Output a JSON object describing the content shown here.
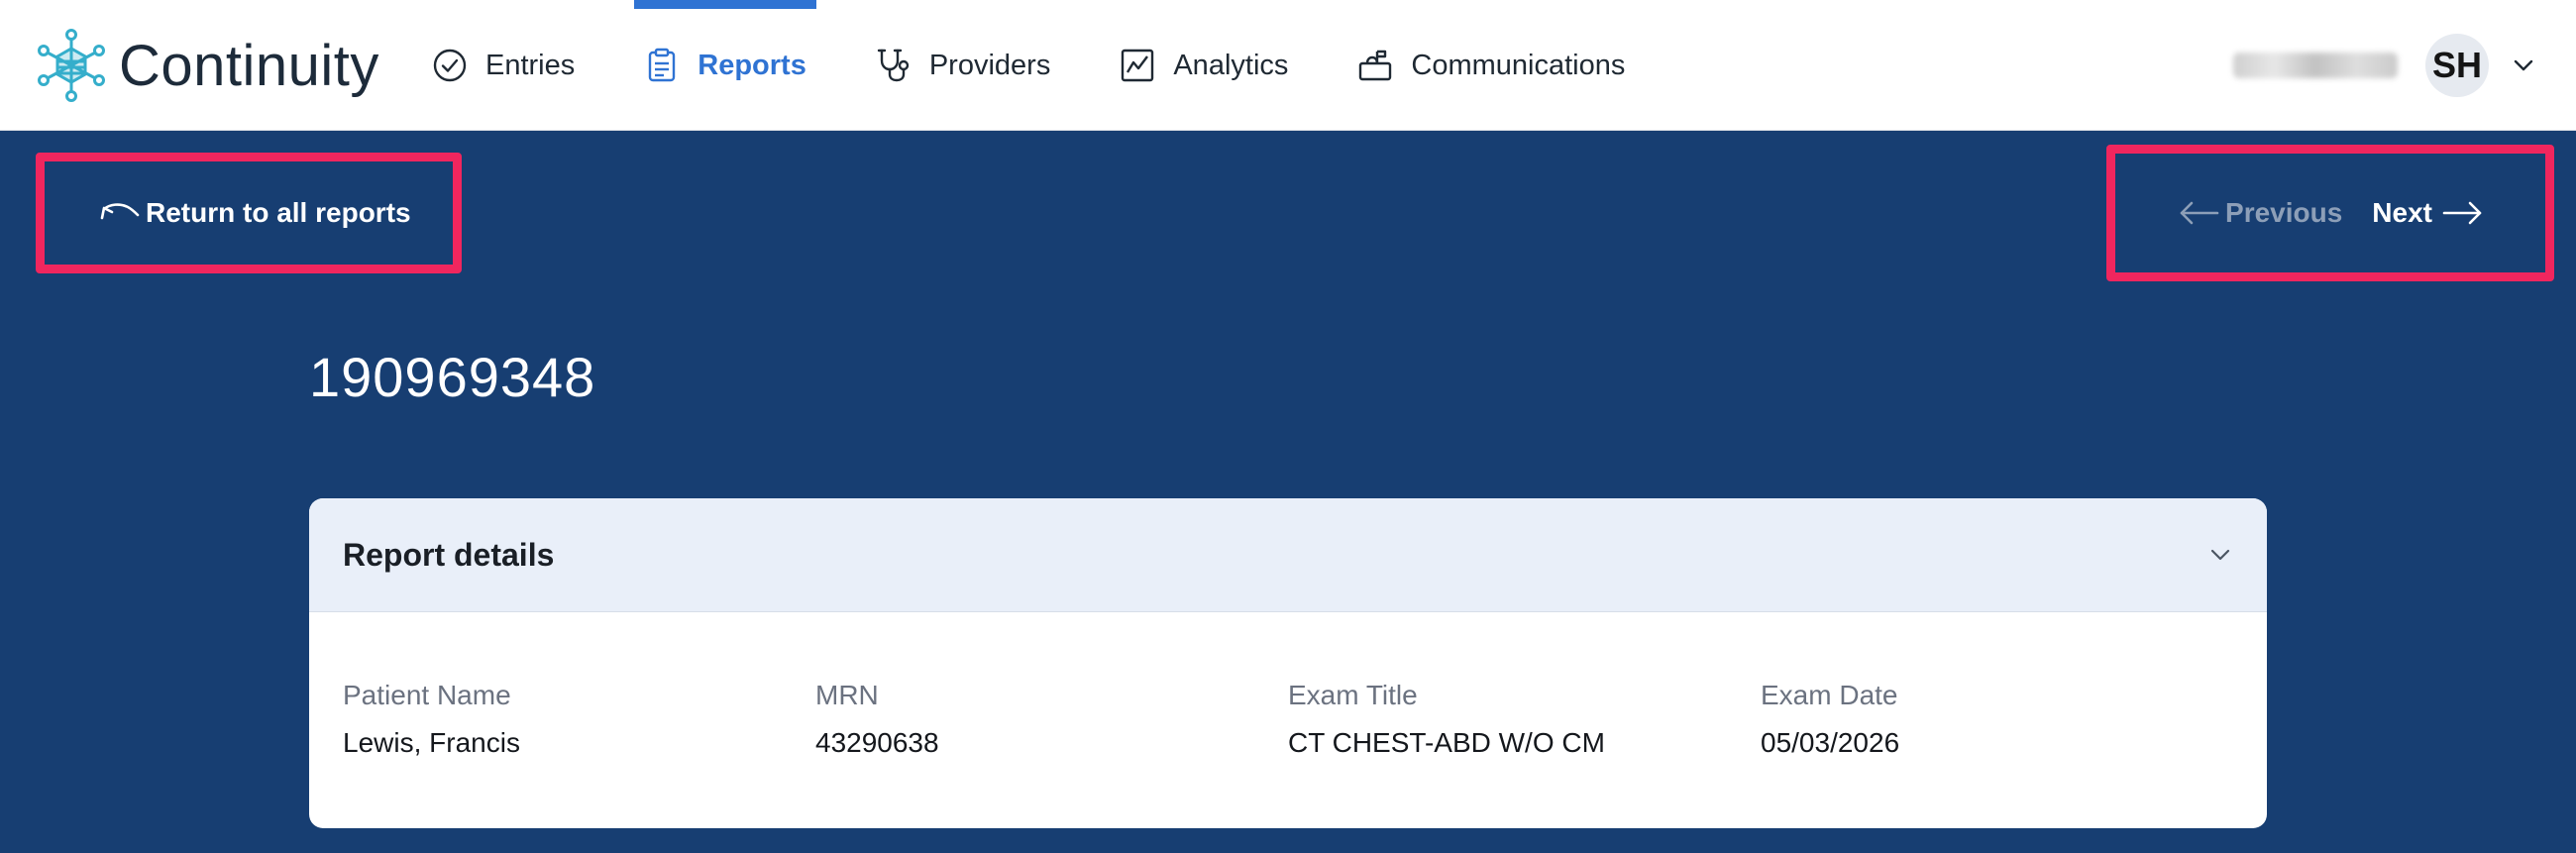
{
  "app": {
    "name": "Continuity"
  },
  "nav": {
    "items": [
      {
        "label": "Entries",
        "icon": "check-circle-icon",
        "active": false
      },
      {
        "label": "Reports",
        "icon": "clipboard-icon",
        "active": true
      },
      {
        "label": "Providers",
        "icon": "stethoscope-icon",
        "active": false
      },
      {
        "label": "Analytics",
        "icon": "chart-line-icon",
        "active": false
      },
      {
        "label": "Communications",
        "icon": "mailbox-icon",
        "active": false
      }
    ]
  },
  "user": {
    "initials": "SH"
  },
  "actions": {
    "return_label": "Return to all reports",
    "previous_label": "Previous",
    "next_label": "Next"
  },
  "report": {
    "id": "190969348",
    "details_title": "Report details",
    "fields": [
      {
        "label": "Patient Name",
        "value": "Lewis, Francis"
      },
      {
        "label": "MRN",
        "value": "43290638"
      },
      {
        "label": "Exam Title",
        "value": "CT CHEST-ABD W/O CM"
      },
      {
        "label": "Exam Date",
        "value": "05/03/2026"
      }
    ]
  },
  "colors": {
    "background": "#173e72",
    "accent": "#2f73d3",
    "highlight": "#f0265e",
    "card_header": "#e9eff9"
  }
}
